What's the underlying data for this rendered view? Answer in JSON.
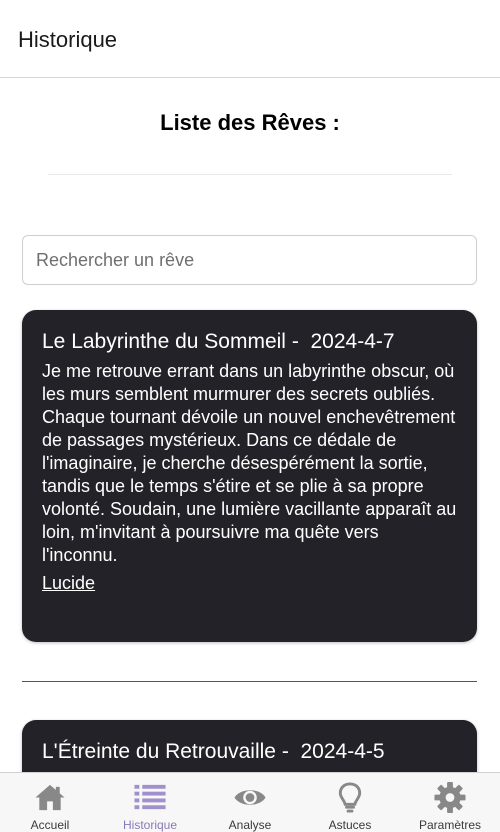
{
  "header": {
    "title": "Historique"
  },
  "main": {
    "heading": "Liste des Rêves :",
    "search": {
      "placeholder": "Rechercher un rêve",
      "value": ""
    },
    "dreams": [
      {
        "title": "Le Labyrinthe du Sommeil",
        "separator": " -  ",
        "date": "2024-4-7",
        "text": "Je me retrouve errant dans un labyrinthe obscur, où les murs semblent murmurer des secrets oubliés. Chaque tournant dévoile un nouvel enchevêtrement de passages mystérieux. Dans ce dédale de l'imaginaire, je cherche désespérément la sortie, tandis que le temps s'étire et se plie à sa propre volonté. Soudain, une lumière vacillante apparaît au loin, m'invitant à poursuivre ma quête vers l'inconnu.",
        "tag": "Lucide"
      },
      {
        "title": "L'Étreinte du Retrouvaille",
        "separator": " -  ",
        "date": "2024-4-5"
      }
    ]
  },
  "nav": {
    "items": [
      {
        "label": "Accueil",
        "icon": "home-icon"
      },
      {
        "label": "Historique",
        "icon": "list-icon",
        "active": true
      },
      {
        "label": "Analyse",
        "icon": "eye-icon"
      },
      {
        "label": "Astuces",
        "icon": "lightbulb-icon"
      },
      {
        "label": "Paramètres",
        "icon": "gear-icon"
      }
    ],
    "colors": {
      "icon": "#888888",
      "active_icon": "#a090cc",
      "card_bg": "#232228"
    }
  }
}
